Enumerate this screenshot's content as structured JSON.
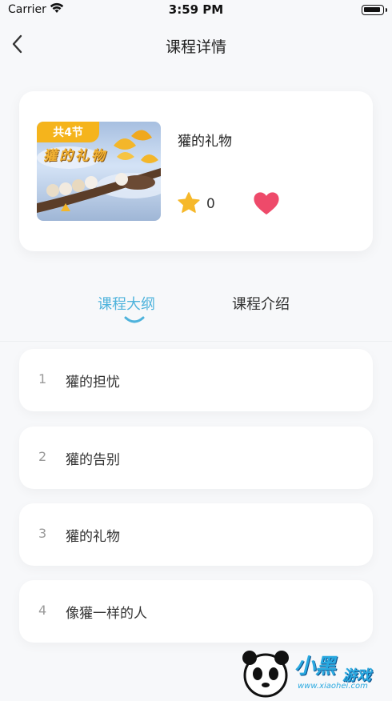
{
  "status_bar": {
    "carrier": "Carrier",
    "time": "3:59 PM"
  },
  "navbar": {
    "title": "课程详情"
  },
  "course": {
    "badge": "共4节",
    "cover_title": "獾的礼物",
    "title": "獾的礼物",
    "star_count": "0"
  },
  "tabs": [
    {
      "label": "课程大纲",
      "active": true
    },
    {
      "label": "课程介绍",
      "active": false
    }
  ],
  "lessons": [
    {
      "num": "1",
      "title": "獾的担忧"
    },
    {
      "num": "2",
      "title": "獾的告别"
    },
    {
      "num": "3",
      "title": "獾的礼物"
    },
    {
      "num": "4",
      "title": "像獾一样的人"
    }
  ],
  "watermark": {
    "brand": "小黑",
    "game": "游戏",
    "url": "www.xiaohei.com"
  },
  "colors": {
    "accent": "#4fb3dc",
    "badge": "#f5b41c",
    "heart": "#ee4a6a",
    "star": "#f6b82a"
  }
}
